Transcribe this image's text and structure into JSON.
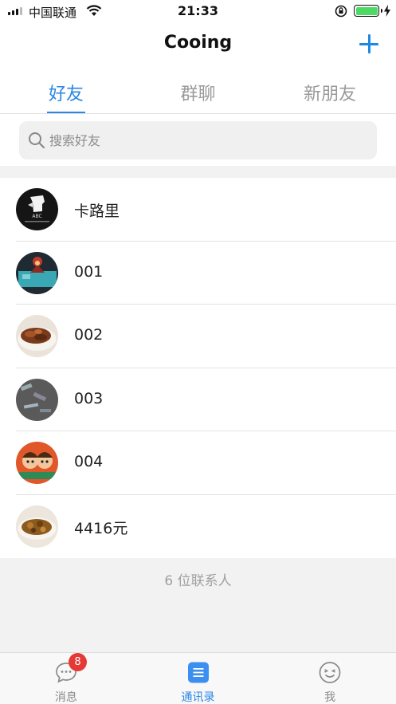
{
  "status_bar": {
    "carrier": "中国联通",
    "time": "21:33"
  },
  "nav": {
    "title": "Cooing",
    "add_icon": "plus-icon"
  },
  "tabs": [
    {
      "label": "好友",
      "active": true
    },
    {
      "label": "群聊",
      "active": false
    },
    {
      "label": "新朋友",
      "active": false
    }
  ],
  "search": {
    "placeholder": "搜索好友",
    "value": ""
  },
  "contacts": [
    {
      "name": "卡路里",
      "avatar_text": "ABC"
    },
    {
      "name": "001"
    },
    {
      "name": "002"
    },
    {
      "name": "003"
    },
    {
      "name": "004"
    },
    {
      "name": "4416元"
    }
  ],
  "contact_count": "6 位联系人",
  "tab_bar": {
    "messages": {
      "label": "消息",
      "badge": "8",
      "icon": "chat-bubble-icon"
    },
    "contacts": {
      "label": "通讯录",
      "icon": "contacts-book-icon"
    },
    "me": {
      "label": "我",
      "icon": "smiley-face-icon"
    }
  },
  "colors": {
    "accent": "#2b86e6",
    "badge": "#e53935",
    "battery": "#4cd964"
  }
}
